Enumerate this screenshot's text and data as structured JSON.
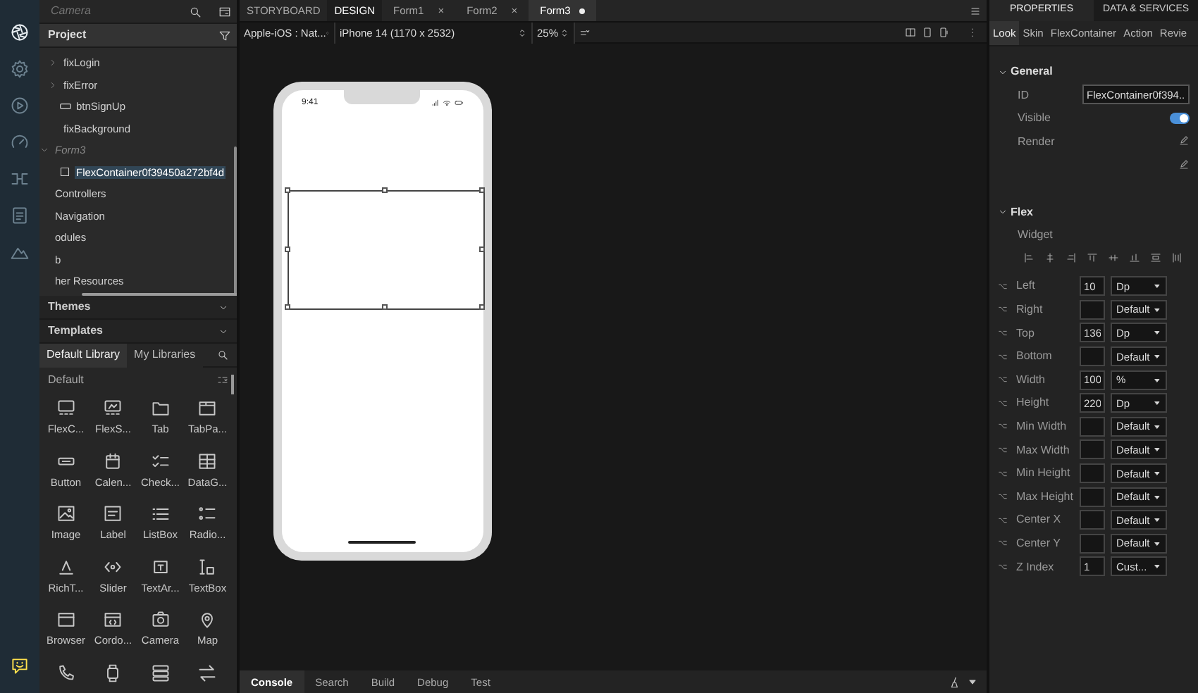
{
  "rail": [
    {
      "kind": "aperture",
      "selected": true
    },
    {
      "kind": "gear",
      "selected": false
    },
    {
      "kind": "play",
      "selected": false
    },
    {
      "kind": "gauge",
      "selected": false
    },
    {
      "kind": "flow",
      "selected": false
    },
    {
      "kind": "doc",
      "selected": false
    },
    {
      "kind": "mountain",
      "selected": false
    },
    {
      "kind": "chat"
    }
  ],
  "left_panel": {
    "search": {
      "placeholder": "Camera"
    },
    "project": {
      "title": "Project"
    },
    "tree": [
      {
        "children": [
          {
            "label": "fixLogin",
            "expanded": false
          },
          {
            "label": "fixError",
            "expanded": false
          },
          {
            "label": "btnSignUp",
            "kind": "button"
          },
          {
            "label": "fixBackground"
          }
        ]
      },
      {
        "label": "Form3",
        "kind": "form",
        "expanded": true,
        "children": [
          {
            "label": "FlexContainer0f39450a272bf4d",
            "kind": "container",
            "selected": true
          }
        ]
      },
      {
        "label": "Controllers"
      },
      {
        "label": "Navigation"
      },
      {
        "label": "odules"
      },
      {
        "label": "b"
      },
      {
        "label": "her Resources"
      }
    ],
    "sections": [
      {
        "label": "Themes",
        "expanded": false
      },
      {
        "label": "Templates",
        "expanded": false
      }
    ],
    "library": {
      "tabs": [
        {
          "label": "Default Library",
          "selected": true
        },
        {
          "label": "My Libraries",
          "selected": false
        }
      ],
      "group": "Default",
      "widgets": [
        {
          "label": "FlexC...",
          "kind": "flex"
        },
        {
          "label": "FlexS...",
          "kind": "flexscroll"
        },
        {
          "label": "Tab",
          "kind": "tab"
        },
        {
          "label": "TabPa...",
          "kind": "tabpane"
        },
        {
          "label": "Button",
          "kind": "button"
        },
        {
          "label": "Calen...",
          "kind": "calendar"
        },
        {
          "label": "Check...",
          "kind": "checkbox"
        },
        {
          "label": "DataG...",
          "kind": "datagrid"
        },
        {
          "label": "Image",
          "kind": "image"
        },
        {
          "label": "Label",
          "kind": "label"
        },
        {
          "label": "ListBox",
          "kind": "listbox"
        },
        {
          "label": "Radio...",
          "kind": "radio"
        },
        {
          "label": "RichT...",
          "kind": "richtext"
        },
        {
          "label": "Slider",
          "kind": "slider"
        },
        {
          "label": "TextAr...",
          "kind": "textarea"
        },
        {
          "label": "TextBox",
          "kind": "textbox"
        },
        {
          "label": "Browser",
          "kind": "browser"
        },
        {
          "label": "Cordo...",
          "kind": "cordova"
        },
        {
          "label": "Camera",
          "kind": "camera"
        },
        {
          "label": "Map",
          "kind": "map"
        },
        {
          "kind": "phone"
        },
        {
          "kind": "watch"
        },
        {
          "kind": "segment"
        },
        {
          "kind": "switch"
        }
      ]
    }
  },
  "editor": {
    "mode_tabs": [
      {
        "label": "STORYBOARD",
        "selected": false
      },
      {
        "label": "DESIGN",
        "selected": true
      }
    ],
    "doc_tabs": [
      {
        "label": "Form1",
        "close": "×",
        "selected": false,
        "modified": false
      },
      {
        "label": "Form2",
        "close": "×",
        "selected": false,
        "modified": false
      },
      {
        "label": "Form3",
        "selected": true,
        "modified": true
      }
    ],
    "toolbar": {
      "platform": "Apple-iOS : Nat...",
      "device": "iPhone 14 (1170 x 2532)",
      "zoom": "25%"
    },
    "phone": {
      "time": "9:41"
    },
    "bottom_tabs": [
      {
        "label": "Console",
        "selected": true
      },
      {
        "label": "Search",
        "selected": false
      },
      {
        "label": "Build",
        "selected": false
      },
      {
        "label": "Debug",
        "selected": false
      },
      {
        "label": "Test",
        "selected": false
      }
    ]
  },
  "properties": {
    "tabs": [
      {
        "label": "PROPERTIES",
        "selected": true
      },
      {
        "label": "DATA & SERVICES",
        "selected": false
      }
    ],
    "sub_tabs": [
      {
        "label": "Look",
        "selected": true
      },
      {
        "label": "Skin",
        "selected": false
      },
      {
        "label": "FlexContainer",
        "selected": false
      },
      {
        "label": "Action",
        "selected": false
      },
      {
        "label": "Revie",
        "selected": false
      }
    ],
    "general": {
      "title": "General",
      "rows": [
        {
          "kind": "field",
          "label": "ID",
          "value": "FlexContainer0f394..."
        },
        {
          "kind": "toggle",
          "label": "Visible",
          "on": true
        },
        {
          "kind": "edit",
          "label": "Render"
        },
        {
          "kind": "edit"
        }
      ]
    },
    "flex": {
      "title": "Flex",
      "subtitle": "Widget",
      "rows": [
        {
          "label": "Left",
          "value": "10",
          "unit": "Dp"
        },
        {
          "label": "Right",
          "unit": "Default"
        },
        {
          "label": "Top",
          "value": "136",
          "unit": "Dp"
        },
        {
          "label": "Bottom",
          "unit": "Default"
        },
        {
          "label": "Width",
          "value": "100",
          "unit": "%"
        },
        {
          "label": "Height",
          "value": "220",
          "unit": "Dp"
        },
        {
          "label": "Min Width",
          "unit": "Default"
        },
        {
          "label": "Max Width",
          "unit": "Default"
        },
        {
          "label": "Min Height",
          "unit": "Default"
        },
        {
          "label": "Max Height",
          "unit": "Default"
        },
        {
          "label": "Center X",
          "unit": "Default"
        },
        {
          "label": "Center Y",
          "unit": "Default"
        },
        {
          "label": "Z Index",
          "value": "1",
          "unit": "Cust..."
        }
      ]
    }
  }
}
